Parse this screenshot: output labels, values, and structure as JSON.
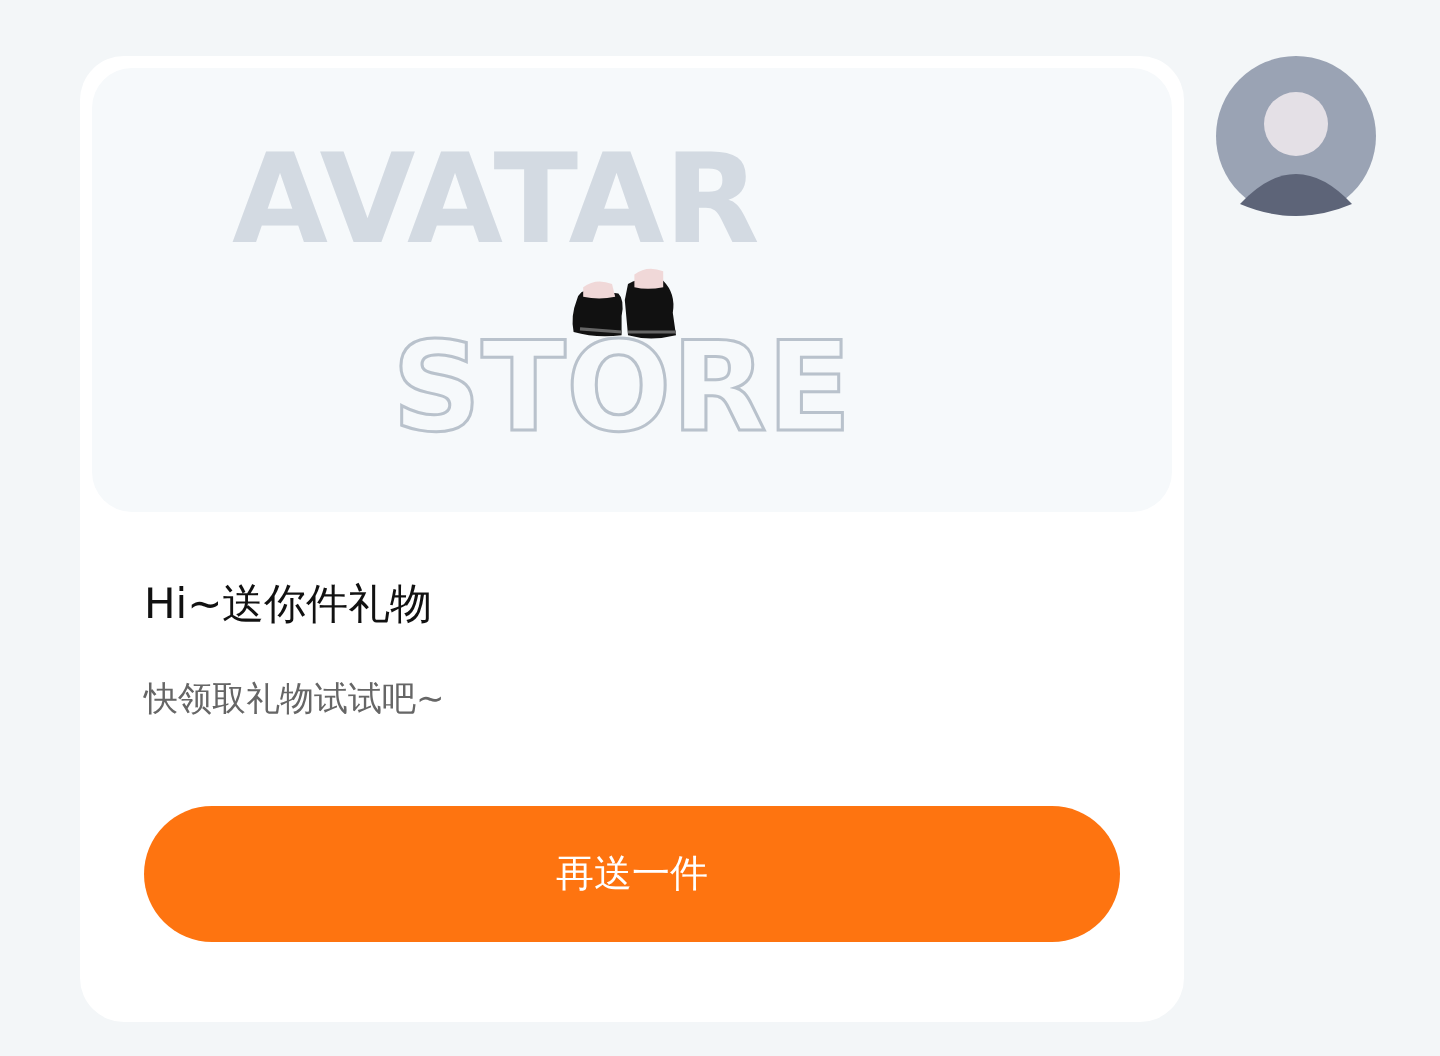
{
  "gift_card": {
    "banner_words": [
      "AVATAR",
      "STORE"
    ],
    "title": "Hi~送你件礼物",
    "subtitle": "快领取礼物试试吧~",
    "button": "再送一件"
  },
  "sender": {
    "kind": "avatar"
  }
}
